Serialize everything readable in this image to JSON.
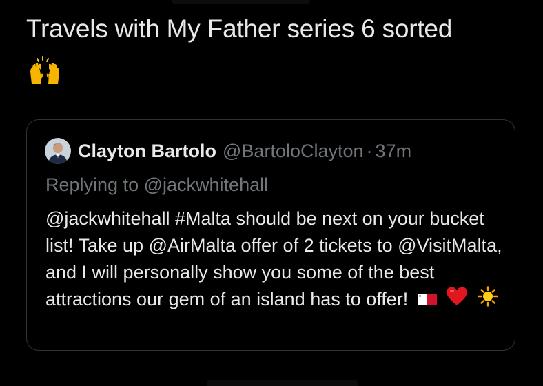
{
  "tweet": {
    "text": "Travels with My Father series 6 sorted",
    "emoji_icon": "raising-hands-emoji"
  },
  "quote": {
    "author_name": "Clayton Bartolo",
    "author_handle": "@BartoloClayton",
    "separator": "·",
    "time": "37m",
    "replying_prefix": "Replying to",
    "replying_handle": "@jackwhitehall",
    "body": "@jackwhitehall #Malta should be next on your bucket list! Take up @AirMalta offer of 2 tickets to @VisitMalta, and I will personally show you some of the best attractions our gem of an island has to offer!",
    "trailing_emojis": [
      "flag-malta-icon",
      "red-heart-icon",
      "sun-icon"
    ]
  },
  "colors": {
    "background": "#000000",
    "text_primary": "#e7e9ea",
    "text_secondary": "#71767b",
    "card_border": "#2f3336"
  }
}
